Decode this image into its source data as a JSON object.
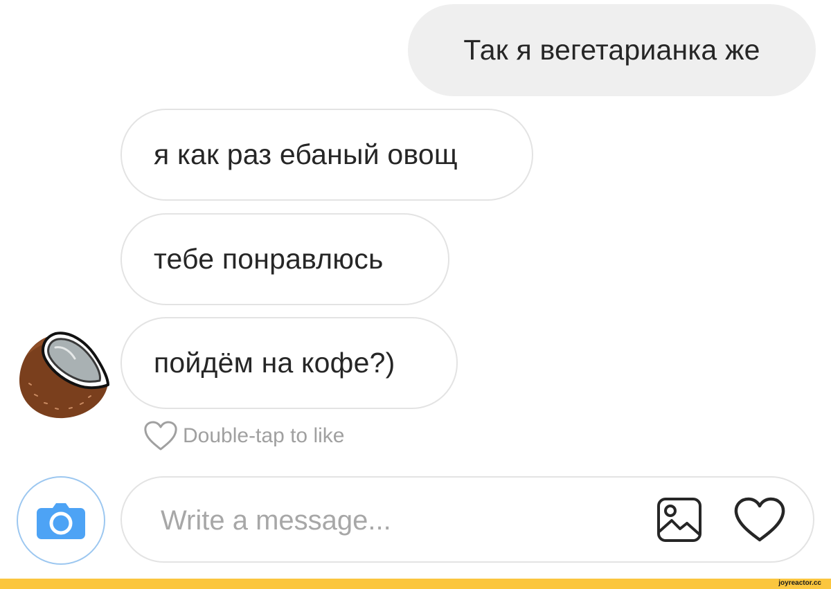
{
  "conversation": {
    "messages": [
      {
        "direction": "outgoing",
        "text": "Так я вегетарианка же"
      },
      {
        "direction": "incoming",
        "text": "я как раз ебаный овощ"
      },
      {
        "direction": "incoming",
        "text": "тебе понравлюсь"
      },
      {
        "direction": "incoming",
        "text": "пойдём на кофе?)"
      }
    ],
    "like_hint": "Double-tap to like",
    "avatar_icon": "coconut-icon"
  },
  "composer": {
    "placeholder": "Write a message...",
    "value": "",
    "camera_icon": "camera-icon",
    "gallery_icon": "image-gallery-icon",
    "like_icon": "heart-icon"
  },
  "colors": {
    "outgoing_bubble": "#efefef",
    "incoming_border": "#e3e3e3",
    "camera_blue": "#4da3f5",
    "footer_yellow": "#fbc63e"
  },
  "watermark": "joyreactor.cc"
}
